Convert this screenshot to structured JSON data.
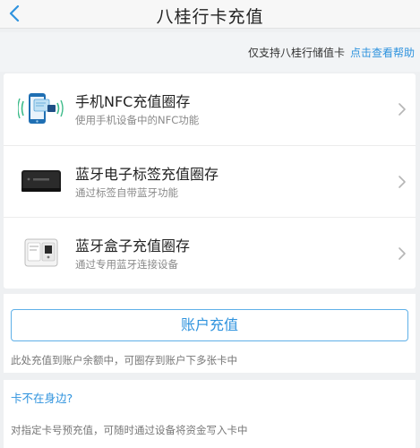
{
  "header": {
    "title": "八桂行卡充值"
  },
  "notice": {
    "text": "仅支持八桂行储值卡",
    "help_link": "点击查看帮助"
  },
  "methods": [
    {
      "title": "手机NFC充值圈存",
      "desc": "使用手机设备中的NFC功能",
      "icon": "phone-nfc-icon"
    },
    {
      "title": "蓝牙电子标签充值圈存",
      "desc": "通过标签自带蓝牙功能",
      "icon": "bluetooth-tag-device-icon"
    },
    {
      "title": "蓝牙盒子充值圈存",
      "desc": "通过专用蓝牙连接设备",
      "icon": "bluetooth-box-device-icon"
    }
  ],
  "account": {
    "button": "账户充值",
    "note": "此处充值到账户余额中，可圈存到账户下多张卡中"
  },
  "card_away": {
    "link": "卡不在身边?",
    "note": "对指定卡号预充值，可随时通过设备将资金写入卡中"
  },
  "colors": {
    "accent": "#2f93de",
    "background": "#eef0f2"
  }
}
